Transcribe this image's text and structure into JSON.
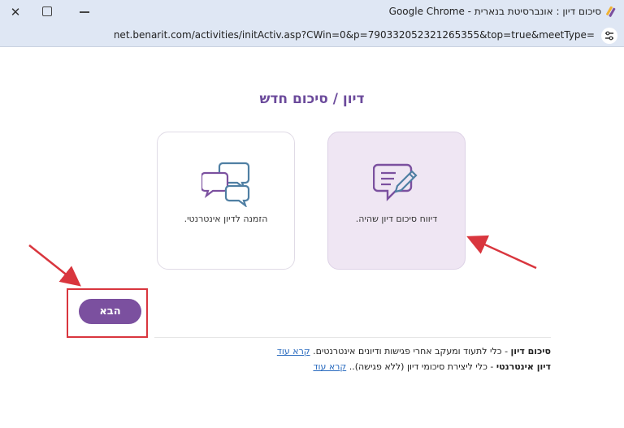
{
  "browser": {
    "window_title": "סיכום דיון : אונברסיטת בנארית - Google Chrome",
    "url": "net.benarit.com/activities/initActiv.asp?CWin=0&p=790332052321265355&top=true&meetType="
  },
  "page": {
    "title": "דיון / סיכום חדש",
    "cards": [
      {
        "label": "דיווח סיכום דיון שהיה.",
        "icon": "chat-pen-icon",
        "selected": true
      },
      {
        "label": "הזמנה לדיון אינטרנטי.",
        "icon": "chat-bubbles-icon",
        "selected": false
      }
    ],
    "next_button": "הבא",
    "descriptions": [
      {
        "term": "סיכום דיון",
        "text": " - כלי לתעוד ומעקב אחרי פגישות ודיונים אינטרנטים. ",
        "link": "קרא עוד"
      },
      {
        "term": "דיון אינטרנטי",
        "text": " - כלי ליצירת סיכומי דיון (ללא פגישה).. ",
        "link": "קרא עוד"
      }
    ]
  },
  "colors": {
    "brand_purple": "#7b509f",
    "title_purple": "#6b4a9b",
    "selected_card_bg": "#efe6f3",
    "annotation_red": "#d9363e"
  }
}
